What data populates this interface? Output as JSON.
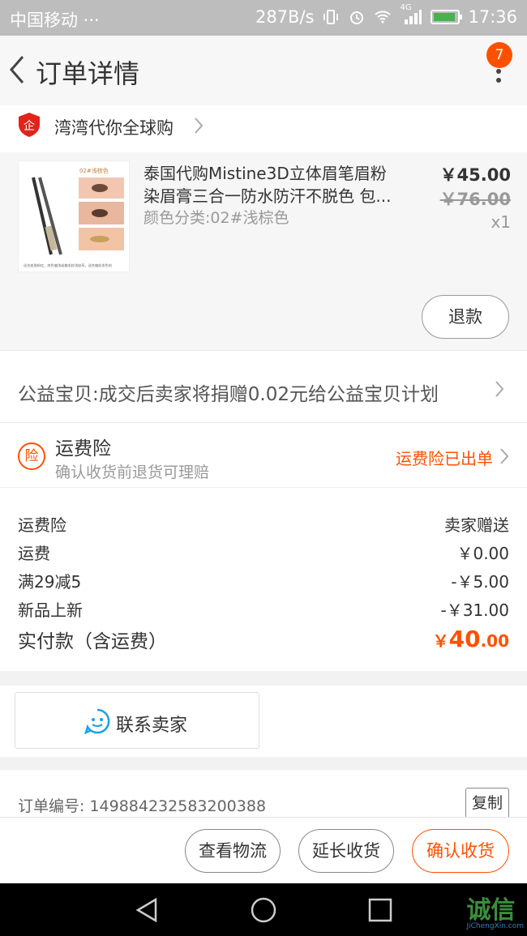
{
  "status_bar": {
    "carrier": "中国移动 ···",
    "speed": "287B/s",
    "network": "4G",
    "time": "17:36"
  },
  "header": {
    "title": "订单详情",
    "badge_count": "7"
  },
  "shop": {
    "logo_text": "企",
    "name": "湾湾代你全球购"
  },
  "product": {
    "name_line1": "泰国代购Mistine3D立体眉笔眉粉",
    "name_line2": "染眉膏三合一防水防汗不脱色 包...",
    "sku": "颜色分类:02#浅棕色",
    "price": "￥45.00",
    "original_price": "￥76.00",
    "quantity": "x1",
    "image_tag": "02#浅棕色",
    "image_caption": "适合皮肤粉红，底色偏浅或偏毛较浅较亮，适合偏毛发色的",
    "refund_label": "退款"
  },
  "charity": {
    "text": "公益宝贝:成交后卖家将捐赠0.02元给公益宝贝计划"
  },
  "insurance": {
    "icon_text": "险",
    "title": "运费险",
    "subtitle": "确认收货前退货可理赔",
    "status": "运费险已出单"
  },
  "fees": [
    {
      "label": "运费险",
      "value": "卖家赠送"
    },
    {
      "label": "运费",
      "value": "￥0.00"
    },
    {
      "label": "满29减5",
      "value": "-￥5.00"
    },
    {
      "label": "新品上新",
      "value": "-￥31.00"
    }
  ],
  "total": {
    "label": "实付款（含运费）",
    "currency": "￥",
    "integer": "40",
    "decimal": ".00"
  },
  "contact": {
    "label": "联系卖家"
  },
  "order": {
    "number_label": "订单编号: 1498842325832003​88",
    "copy_label": "复制"
  },
  "actions": {
    "logistics": "查看物流",
    "extend": "延长收货",
    "confirm": "确认收货"
  },
  "watermark": {
    "text": "诚信",
    "url": "JiChengXin.com"
  },
  "colors": {
    "accent": "#ff5000",
    "status_bar": "#bdbdbd"
  }
}
